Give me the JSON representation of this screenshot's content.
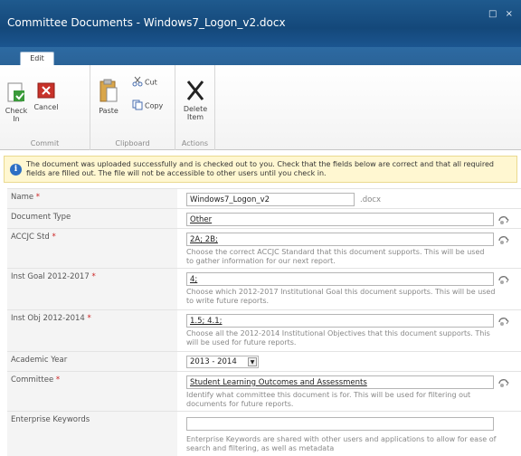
{
  "window": {
    "title": "Committee Documents - Windows7_Logon_v2.docx",
    "controls": "□ ×"
  },
  "ribbon": {
    "tab": "Edit",
    "commit": {
      "label": "Commit",
      "check_in": "Check In",
      "cancel": "Cancel"
    },
    "clipboard": {
      "label": "Clipboard",
      "paste": "Paste",
      "cut": "Cut",
      "copy": "Copy"
    },
    "actions": {
      "label": "Actions",
      "delete_item": "Delete Item"
    }
  },
  "notification": "The document was uploaded successfully and is checked out to you. Check that the fields below are correct and that all required fields are filled out. The file will not be accessible to other users until you check in.",
  "form": {
    "name": {
      "label": "Name",
      "value": "Windows7_Logon_v2",
      "suffix": ".docx"
    },
    "doc_type": {
      "label": "Document Type",
      "value": "Other"
    },
    "accjc_std": {
      "label": "ACCJC Std",
      "value": "2A; 2B;",
      "desc": "Choose the correct ACCJC Standard that this document supports. This will be used to gather information for our next report."
    },
    "inst_goal": {
      "label": "Inst Goal 2012-2017",
      "value": "4;",
      "desc": "Choose which 2012-2017 Institutional Goal this document supports. This will be used to write future reports."
    },
    "inst_obj": {
      "label": "Inst Obj 2012-2014",
      "value": "1.5; 4.1;",
      "desc": "Choose all the 2012-2014 Institutional Objectives that this document supports.  This will be used for future reports."
    },
    "academic_year": {
      "label": "Academic Year",
      "value": "2013 - 2014"
    },
    "committee": {
      "label": "Committee",
      "value": "Student Learning Outcomes and Assessments",
      "desc": "Identify what committee this document is for.  This will be used for filtering out documents for future reports."
    },
    "keywords": {
      "label": "Enterprise Keywords",
      "value": "",
      "desc": "Enterprise Keywords are shared with other users and applications to allow for ease of search and filtering, as well as metadata"
    }
  },
  "colors": {
    "titlebar": "#1b5590",
    "required": "#cc2222",
    "notify_bg": "#fff7d1"
  }
}
